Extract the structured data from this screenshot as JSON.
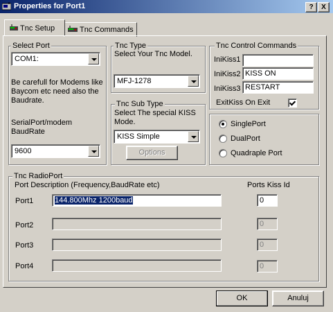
{
  "window": {
    "title": "Properties for Port1",
    "help_btn": "?",
    "close_btn": "X"
  },
  "tabs": [
    {
      "label": "Tnc Setup"
    },
    {
      "label": "Tnc Commands"
    }
  ],
  "select_port": {
    "group_label": "Select Port",
    "port_value": "COM1:",
    "warning_line1": "Be carefull for Modems like",
    "warning_line2": "Baycom etc need also the",
    "warning_line3": "Baudrate.",
    "baud_label1": "SerialPort/modem",
    "baud_label2": "BaudRate",
    "baud_value": "9600"
  },
  "tnc_type": {
    "group_label": "Tnc Type",
    "desc": "Select Your Tnc Model.",
    "value": "MFJ-1278"
  },
  "tnc_subtype": {
    "group_label": "Tnc Sub Type",
    "desc1": "Select The special KISS",
    "desc2": "Mode.",
    "value": "KISS Simple",
    "options_btn": "Options"
  },
  "control": {
    "group_label": "Tnc Control Commands",
    "inikiss1_label": "IniKiss1",
    "inikiss1_value": "",
    "inikiss2_label": "IniKiss2",
    "inikiss2_value": "KISS ON",
    "inikiss3_label": "IniKiss3",
    "inikiss3_value": "RESTART",
    "exit_label": "ExitKiss On Exit",
    "exit_checked": true
  },
  "port_mode": {
    "options": [
      "SinglePort",
      "DualPort",
      "Quadraple Port"
    ],
    "selected": "SinglePort"
  },
  "radio_port": {
    "group_label": "Tnc RadioPort",
    "desc_header": "Port Description (Frequency,BaudRate etc)",
    "kiss_header": "Ports Kiss Id",
    "ports": [
      {
        "label": "Port1",
        "description": "144.800Mhz 1200baud",
        "kiss_id": "0"
      },
      {
        "label": "Port2",
        "description": "",
        "kiss_id": "0"
      },
      {
        "label": "Port3",
        "description": "",
        "kiss_id": "0"
      },
      {
        "label": "Port4",
        "description": "",
        "kiss_id": "0"
      }
    ]
  },
  "buttons": {
    "ok": "OK",
    "cancel": "Anuluj"
  }
}
